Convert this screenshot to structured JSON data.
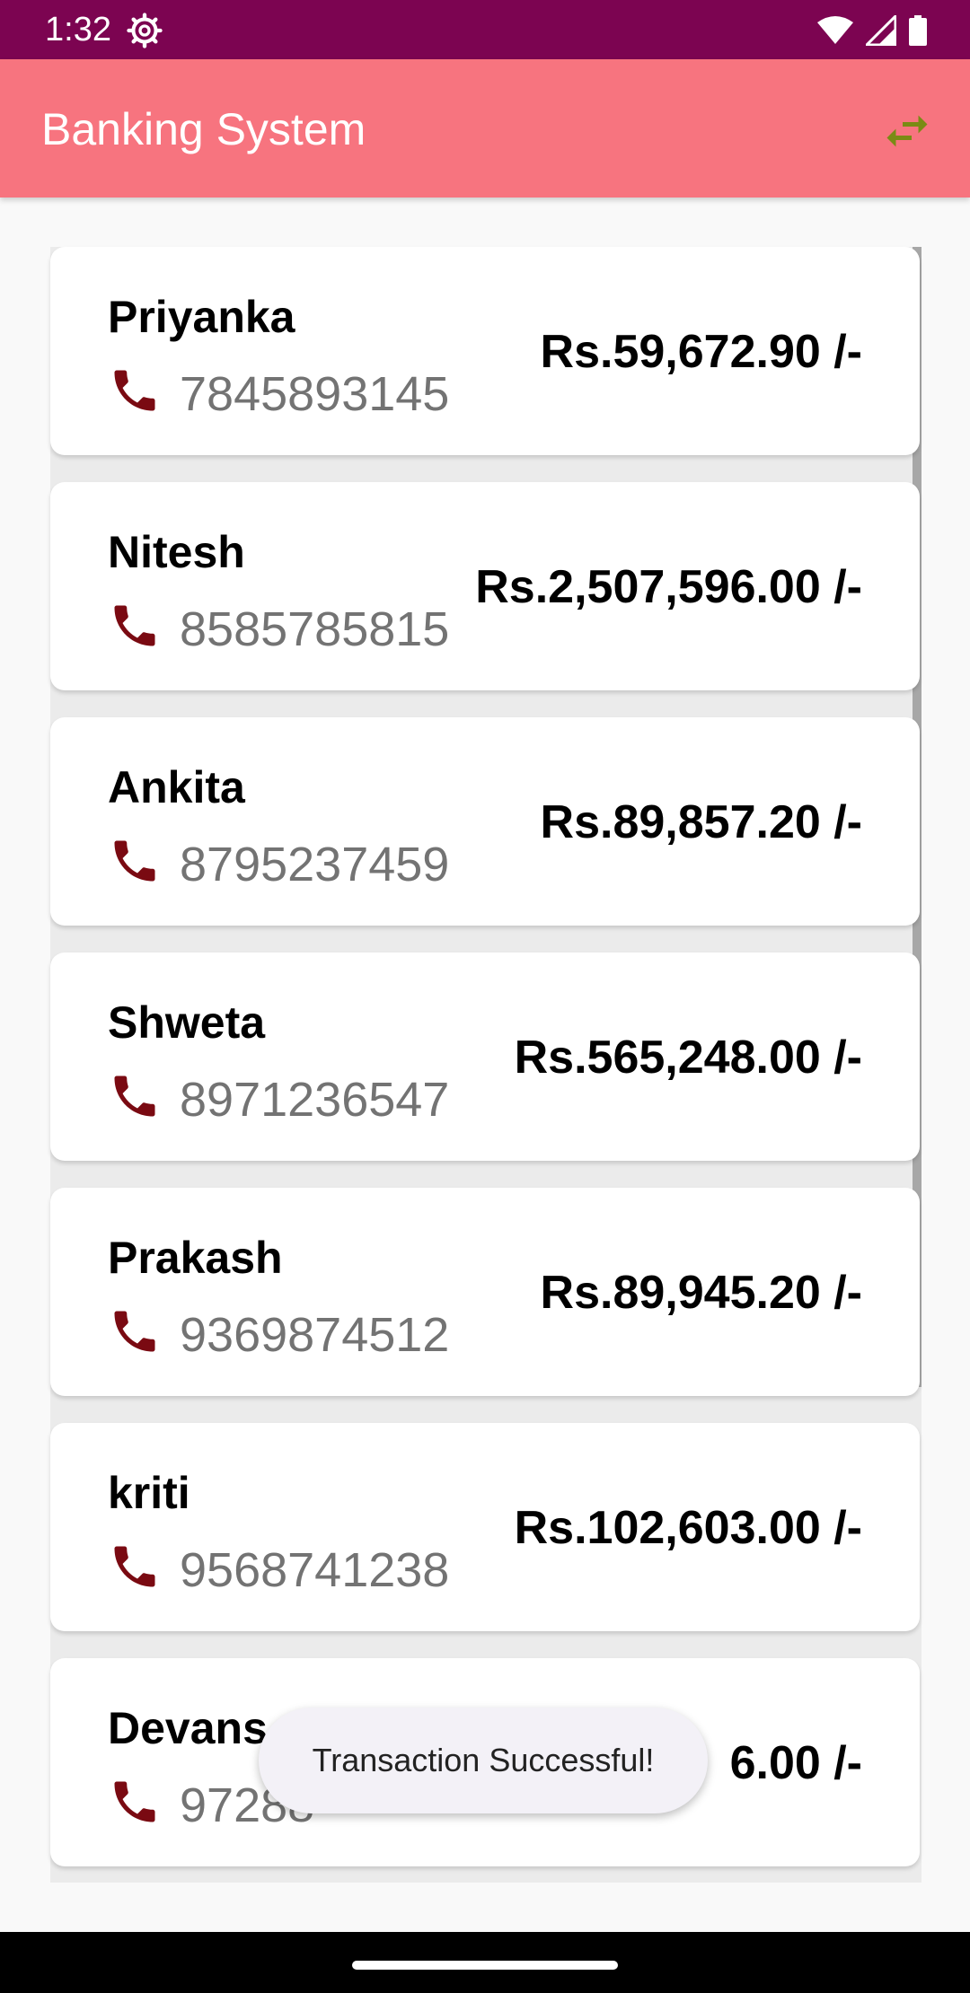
{
  "status_bar": {
    "time": "1:32",
    "icons": [
      "gear-icon",
      "wifi-icon",
      "signal-icon",
      "battery-icon"
    ]
  },
  "app_bar": {
    "title": "Banking System",
    "action_icon": "swap-arrows-icon",
    "background": "#f7747f",
    "action_color": "#7a8b14"
  },
  "customers": [
    {
      "name": "Priyanka",
      "phone": "7845893145",
      "balance": "Rs.59,672.90 /-"
    },
    {
      "name": "Nitesh",
      "phone": "8585785815",
      "balance": "Rs.2,507,596.00 /-"
    },
    {
      "name": "Ankita",
      "phone": "8795237459",
      "balance": "Rs.89,857.20 /-"
    },
    {
      "name": "Shweta",
      "phone": "8971236547",
      "balance": "Rs.565,248.00 /-"
    },
    {
      "name": "Prakash",
      "phone": "9369874512",
      "balance": "Rs.89,945.20 /-"
    },
    {
      "name": "kriti",
      "phone": "9568741238",
      "balance": "Rs.102,603.00 /-"
    },
    {
      "name": "Devans",
      "phone": "97288",
      "balance": "6.00 /-"
    }
  ],
  "phone_icon_color": "#7a0a12",
  "toast": {
    "message": "Transaction Successful!"
  }
}
